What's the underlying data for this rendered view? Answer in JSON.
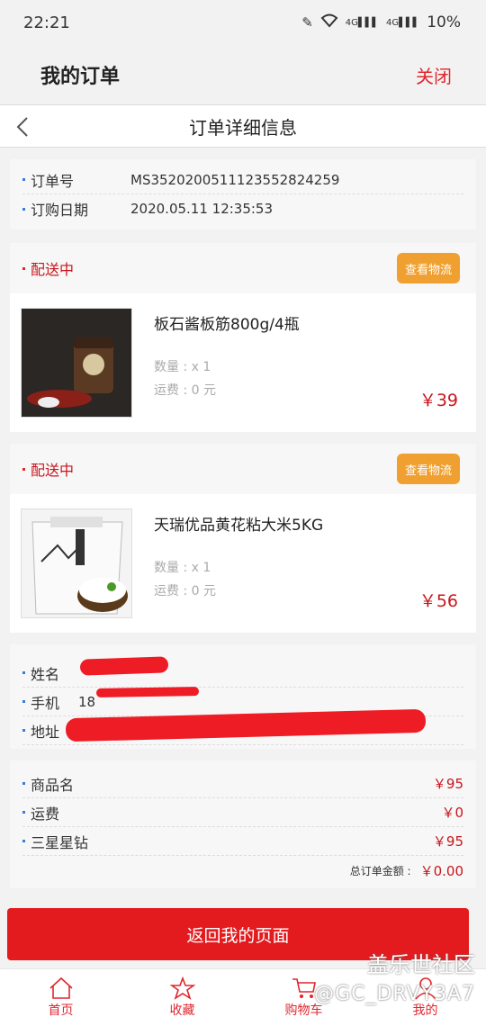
{
  "status_bar": {
    "time": "22:21",
    "signal_1": "4G",
    "signal_2": "4G",
    "battery": "10%"
  },
  "header": {
    "title": "我的订单",
    "close_label": "关闭"
  },
  "nav": {
    "title": "订单详细信息"
  },
  "order_info": {
    "order_no_label": "订单号",
    "order_no": "MS352020051112355282425 9",
    "order_date_label": "订购日期",
    "order_date": "2020.05.11 12:35:53"
  },
  "shipments": [
    {
      "status": "配送中",
      "logistics_label": "查看物流",
      "product_name": "板石酱板筋800g/4瓶",
      "qty": "数量 : x 1",
      "shipping": "运费 : 0 元",
      "price": "￥39"
    },
    {
      "status": "配送中",
      "logistics_label": "查看物流",
      "product_name": "天瑞优品黄花粘大米5KG",
      "qty": "数量 : x 1",
      "shipping": "运费 : 0 元",
      "price": "￥56"
    }
  ],
  "customer": {
    "name_label": "姓名",
    "phone_label": "手机",
    "phone_partial": "18",
    "address_label": "地址"
  },
  "summary": {
    "rows": [
      {
        "label": "商品名",
        "value": "￥95"
      },
      {
        "label": "运费",
        "value": "￥0"
      },
      {
        "label": "三星星钻",
        "value": "￥95"
      }
    ],
    "total_label": "总订单金额 :",
    "total_value": "￥0.00"
  },
  "return_label": "返回我的页面",
  "watermark": {
    "line1": "盖乐世社区",
    "line2": "@GC_DRVY3A7"
  },
  "tabbar": [
    "首页",
    "收藏",
    "购物车",
    "我的"
  ],
  "colors": {
    "accent": "#e0262e",
    "button": "#e41b1e",
    "logistics": "#f0a030",
    "price": "#c8161d"
  }
}
